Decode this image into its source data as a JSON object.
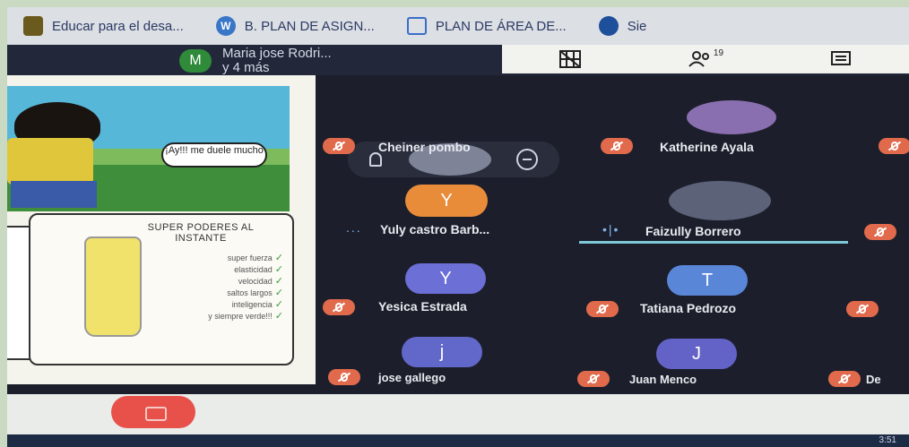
{
  "bookmarks": [
    {
      "label": "Educar para el desa...",
      "icon": "leaf-icon"
    },
    {
      "label": "B. PLAN DE ASIGN...",
      "icon": "wordpress-icon"
    },
    {
      "label": "PLAN DE ÁREA DE...",
      "icon": "table-icon"
    },
    {
      "label": "Sie",
      "icon": "globe-icon"
    }
  ],
  "speaker": {
    "initial": "M",
    "line1": "Maria jose Rodri...",
    "line2": "y 4 más"
  },
  "toolbar": {
    "participants_count": "19"
  },
  "comic": {
    "speech": "¡Ay!!! me duele mucho",
    "panel_title": "SUPER PODERES AL INSTANTE",
    "powers": [
      "super fuerza",
      "elasticidad",
      "velocidad",
      "saltos largos",
      "inteligencia",
      "y siempre verde!!!"
    ]
  },
  "participants": [
    {
      "name": "Cheiner pombo",
      "muted": true
    },
    {
      "name": "Katherine Ayala",
      "muted": true
    },
    {
      "name": "Yuly castro Barb...",
      "initial": "Y",
      "color": "#e88c3a",
      "muted": false,
      "status": "..."
    },
    {
      "name": "Faizully Borrero",
      "muted": false,
      "speaking": true
    },
    {
      "name": "Yesica Estrada",
      "initial": "Y",
      "color": "#6b6fd6",
      "muted": true
    },
    {
      "name": "Tatiana Pedrozo",
      "initial": "T",
      "color": "#5a86d8",
      "muted": true
    },
    {
      "name": "jose gallego",
      "initial": "j",
      "color": "#6168c9",
      "muted": true
    },
    {
      "name": "Juan Menco",
      "initial": "J",
      "color": "#6363c7",
      "muted": true
    },
    {
      "name": "De",
      "muted": true
    }
  ],
  "clock": "3:51"
}
